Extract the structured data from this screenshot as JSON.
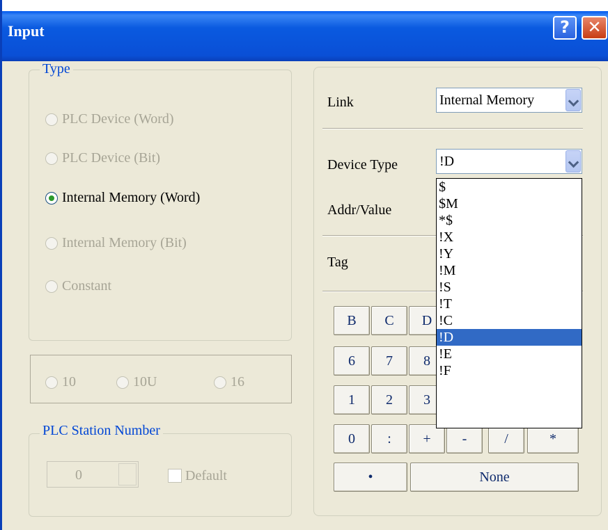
{
  "window": {
    "title": "Input",
    "help_label": "?",
    "close_label": "✕"
  },
  "type_group": {
    "label": "Type",
    "options": [
      {
        "label": "PLC Device (Word)",
        "selected": false,
        "enabled": false
      },
      {
        "label": "PLC Device (Bit)",
        "selected": false,
        "enabled": false
      },
      {
        "label": "Internal Memory (Word)",
        "selected": true,
        "enabled": true
      },
      {
        "label": "Internal Memory (Bit)",
        "selected": false,
        "enabled": false
      },
      {
        "label": "Constant",
        "selected": false,
        "enabled": false
      }
    ]
  },
  "format_group": {
    "options": [
      "10",
      "10U",
      "16"
    ]
  },
  "station_group": {
    "label": "PLC Station Number",
    "value": "0",
    "default_label": "Default"
  },
  "right": {
    "link_label": "Link",
    "link_value": "Internal Memory",
    "device_type_label": "Device Type",
    "device_type_value": "!D",
    "addr_label": "Addr/Value",
    "tag_label": "Tag"
  },
  "dropdown": {
    "items": [
      "$",
      "$M",
      "*$",
      "!X",
      "!Y",
      "!M",
      "!S",
      "!T",
      "!C",
      "!D",
      "!E",
      "!F"
    ],
    "selected": "!D"
  },
  "keypad": {
    "row1": [
      "B",
      "C",
      "D"
    ],
    "row2": [
      "6",
      "7",
      "8"
    ],
    "row3": [
      "1",
      "2",
      "3"
    ],
    "row4": [
      "0",
      ":",
      "+",
      "-",
      "/",
      "*"
    ],
    "dot": "•",
    "none": "None"
  }
}
